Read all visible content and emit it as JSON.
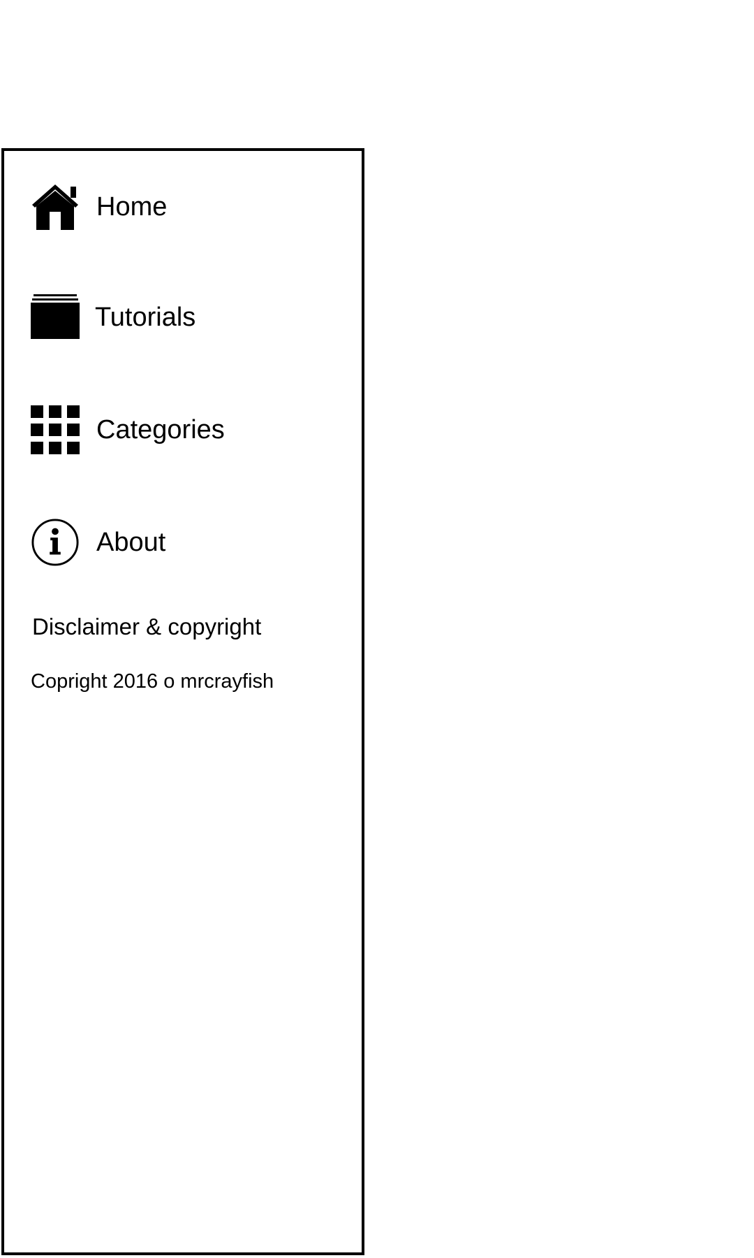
{
  "drawer": {
    "items": [
      {
        "label": "Home",
        "icon": "home-icon"
      },
      {
        "label": "Tutorials",
        "icon": "folder-stack-icon"
      },
      {
        "label": "Categories",
        "icon": "grid-icon"
      },
      {
        "label": "About",
        "icon": "info-icon"
      }
    ],
    "section_heading": "Disclaimer & copyright",
    "copyright_text": "Copright 2016 o mrcrayfish"
  }
}
